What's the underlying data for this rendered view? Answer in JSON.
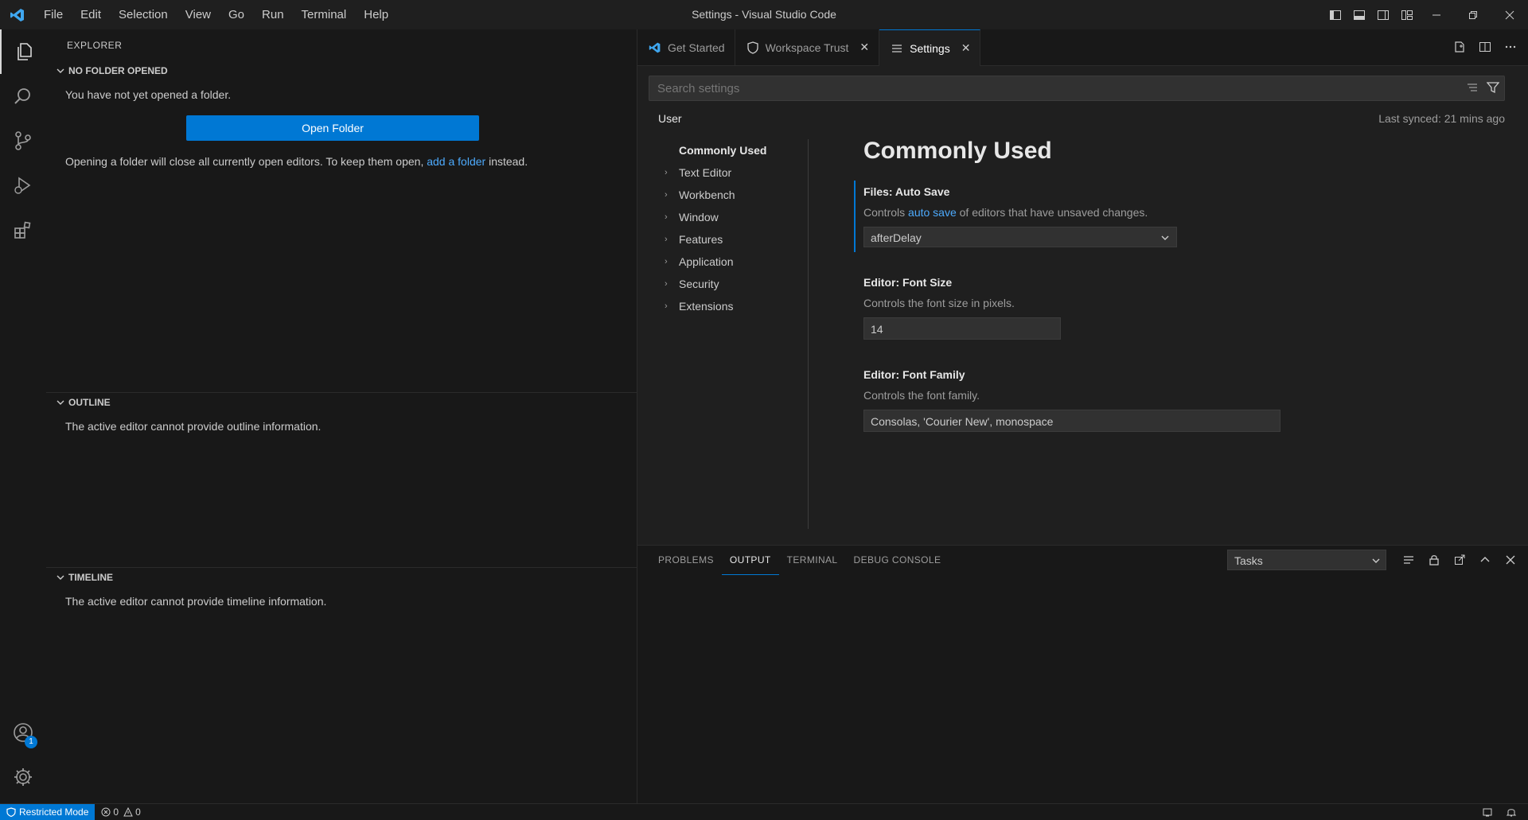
{
  "titlebar": {
    "menu": [
      "File",
      "Edit",
      "Selection",
      "View",
      "Go",
      "Run",
      "Terminal",
      "Help"
    ],
    "window_title": "Settings - Visual Studio Code"
  },
  "activitybar": {
    "items": [
      "explorer-icon",
      "search-icon",
      "source-control-icon",
      "run-debug-icon",
      "extensions-icon"
    ],
    "accounts_badge": "1"
  },
  "sidebar": {
    "title": "EXPLORER",
    "no_folder": {
      "header": "NO FOLDER OPENED",
      "message": "You have not yet opened a folder.",
      "button": "Open Folder",
      "hint_prefix": "Opening a folder will close all currently open editors. To keep them open,",
      "hint_link": "add a folder",
      "hint_suffix": "instead."
    },
    "outline": {
      "header": "OUTLINE",
      "message": "The active editor cannot provide outline information."
    },
    "timeline": {
      "header": "TIMELINE",
      "message": "The active editor cannot provide timeline information."
    }
  },
  "editor": {
    "tabs": [
      {
        "label": "Get Started",
        "icon": "vscode-icon"
      },
      {
        "label": "Workspace Trust",
        "icon": "shield-icon"
      },
      {
        "label": "Settings",
        "icon": "settings-list-icon"
      }
    ],
    "search": {
      "placeholder": "Search settings"
    },
    "scope": "User",
    "last_synced": "Last synced: 21 mins ago",
    "toc": [
      "Commonly Used",
      "Text Editor",
      "Workbench",
      "Window",
      "Features",
      "Application",
      "Security",
      "Extensions"
    ],
    "section_title": "Commonly Used",
    "settings": [
      {
        "title": "Files: Auto Save",
        "desc_prefix": "Controls",
        "desc_link": "auto save",
        "desc_suffix": "of editors that have unsaved changes.",
        "value": "afterDelay"
      },
      {
        "title": "Editor: Font Size",
        "desc": "Controls the font size in pixels.",
        "value": "14"
      },
      {
        "title": "Editor: Font Family",
        "desc": "Controls the font family.",
        "value": "Consolas, 'Courier New', monospace"
      }
    ]
  },
  "panel": {
    "tabs": [
      "PROBLEMS",
      "OUTPUT",
      "TERMINAL",
      "DEBUG CONSOLE"
    ],
    "active_tab": "OUTPUT",
    "task_select": "Tasks"
  },
  "statusbar": {
    "restricted": "Restricted Mode",
    "errors": "0",
    "warnings": "0"
  },
  "colors": {
    "accent": "#0078d4",
    "link": "#4daafc"
  }
}
